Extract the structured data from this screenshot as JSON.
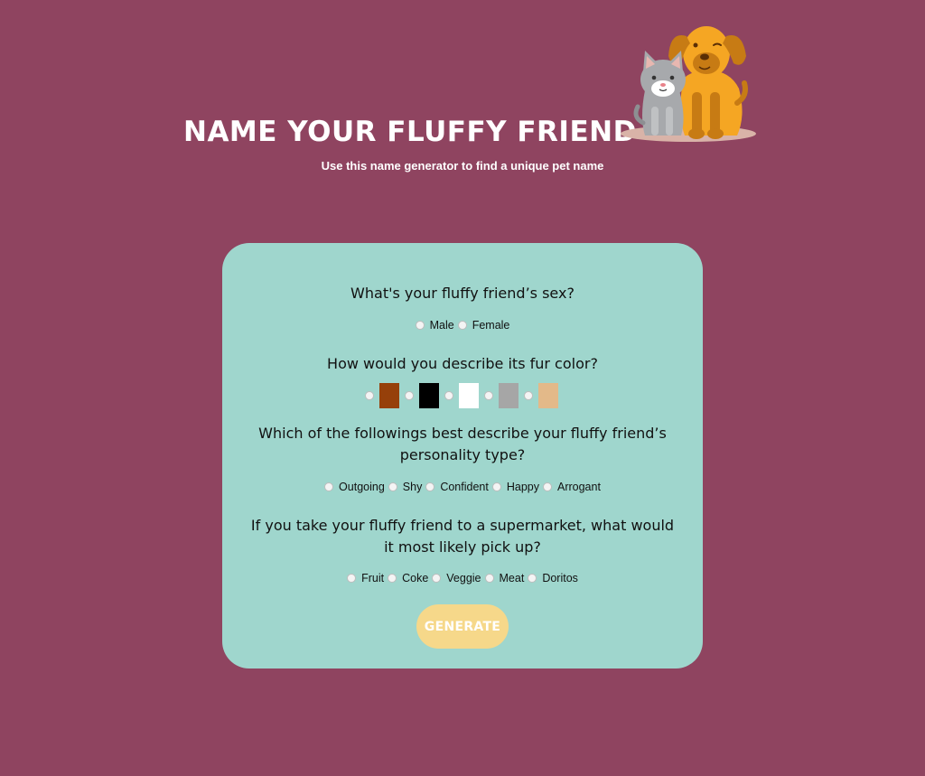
{
  "header": {
    "title": "NAME YOUR FLUFFY FRIEND",
    "subtitle": "Use this name generator to find a unique pet name",
    "illustration": "dog-and-cat-illustration"
  },
  "form": {
    "sex": {
      "question": "What's your fluffy friend’s sex?",
      "options": [
        "Male",
        "Female"
      ]
    },
    "fur": {
      "question": "How would you describe its fur color?",
      "colors": [
        "#96400a",
        "#000000",
        "#ffffff",
        "#a6a6a6",
        "#e3b989"
      ]
    },
    "personality": {
      "question": "Which of the followings best describe your fluffy friend’s personality type?",
      "options": [
        "Outgoing",
        "Shy",
        "Confident",
        "Happy",
        "Arrogant"
      ]
    },
    "supermarket": {
      "question": "If you take your fluffy friend to a supermarket, what would it most likely pick up?",
      "options": [
        "Fruit",
        "Coke",
        "Veggie",
        "Meat",
        "Doritos"
      ]
    },
    "generate_label": "GENERATE"
  },
  "theme": {
    "background": "#8f4460",
    "card": "#9fd6cd",
    "button": "#f6d88a"
  }
}
